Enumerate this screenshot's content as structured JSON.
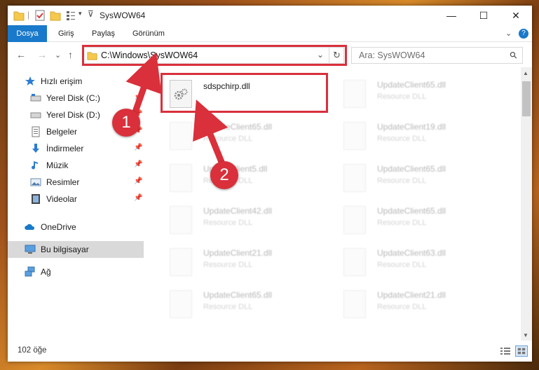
{
  "window": {
    "title": "SysWOW64",
    "controls": {
      "minimize": "—",
      "maximize": "☐",
      "close": "✕"
    }
  },
  "ribbon": {
    "tabs": [
      {
        "label": "Dosya"
      },
      {
        "label": "Giriş"
      },
      {
        "label": "Paylaş"
      },
      {
        "label": "Görünüm"
      }
    ],
    "expand_symbol": "⌄",
    "help_symbol": "?"
  },
  "address_bar": {
    "path": "C:\\Windows\\SysWOW64",
    "dropdown_symbol": "⌄",
    "refresh_symbol": "↻"
  },
  "search": {
    "placeholder": "Ara: SysWOW64",
    "icon_symbol": "⚲"
  },
  "nav_buttons": {
    "back": "←",
    "forward": "→",
    "recent": "⌄",
    "up": "↑"
  },
  "nav_pane": {
    "items": [
      {
        "label": "Hızlı erişim",
        "icon": "star-icon"
      },
      {
        "label": "Yerel Disk (C:)",
        "icon": "drive-icon"
      },
      {
        "label": "Yerel Disk (D:)",
        "icon": "drive-icon"
      },
      {
        "label": "Belgeler",
        "icon": "document-icon"
      },
      {
        "label": "İndirmeler",
        "icon": "download-icon"
      },
      {
        "label": "Müzik",
        "icon": "music-icon"
      },
      {
        "label": "Resimler",
        "icon": "pictures-icon"
      },
      {
        "label": "Videolar",
        "icon": "video-icon"
      },
      {
        "label": "OneDrive",
        "icon": "cloud-icon"
      },
      {
        "label": "Bu bilgisayar",
        "icon": "computer-icon"
      },
      {
        "label": "Ağ",
        "icon": "network-icon"
      }
    ]
  },
  "files": {
    "highlighted": {
      "name": "sdspchirp.dll",
      "type": ""
    },
    "others": [
      {
        "name": "UpdateClient65.dll",
        "type": "Resource DLL"
      },
      {
        "name": "UpdateClient65.dll",
        "type": "Resource DLL"
      },
      {
        "name": "UpdateClient19.dll",
        "type": "Resource DLL"
      },
      {
        "name": "UpdateClient5.dll",
        "type": "Resource DLL"
      },
      {
        "name": "UpdateClient65.dll",
        "type": "Resource DLL"
      },
      {
        "name": "UpdateClient42.dll",
        "type": "Resource DLL"
      },
      {
        "name": "UpdateClient65.dll",
        "type": "Resource DLL"
      },
      {
        "name": "UpdateClient21.dll",
        "type": "Resource DLL"
      },
      {
        "name": "UpdateClient63.dll",
        "type": "Resource DLL"
      },
      {
        "name": "UpdateClient65.dll",
        "type": "Resource DLL"
      },
      {
        "name": "UpdateClient21.dll",
        "type": "Resource DLL"
      }
    ]
  },
  "status_bar": {
    "item_count": "102 öğe"
  },
  "annotations": {
    "step1": "1",
    "step2": "2"
  },
  "colors": {
    "accent": "#1979ca",
    "annotation": "#d9303b"
  }
}
